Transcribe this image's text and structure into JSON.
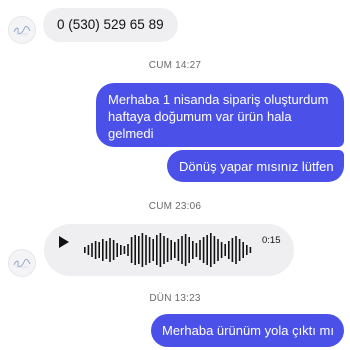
{
  "messages": {
    "phone": "0 (530) 529 65 89",
    "ts1": "CUM 14:27",
    "out1": "Merhaba 1 nisanda sipariş oluşturdum haftaya doğumum var ürün hala gelmedi",
    "out2": "Dönüş yapar mısınız lütfen",
    "ts2": "CUM 23:06",
    "voice_duration": "0:15",
    "ts3": "DÜN 13:23",
    "out3": "Merhaba ürünüm yola çıktı mı"
  },
  "colors": {
    "outgoing_bubble": "#4a50e8",
    "incoming_bubble": "#efeff1"
  },
  "icons": {
    "avatar": "signature-logo-icon",
    "voice": "play-icon"
  }
}
